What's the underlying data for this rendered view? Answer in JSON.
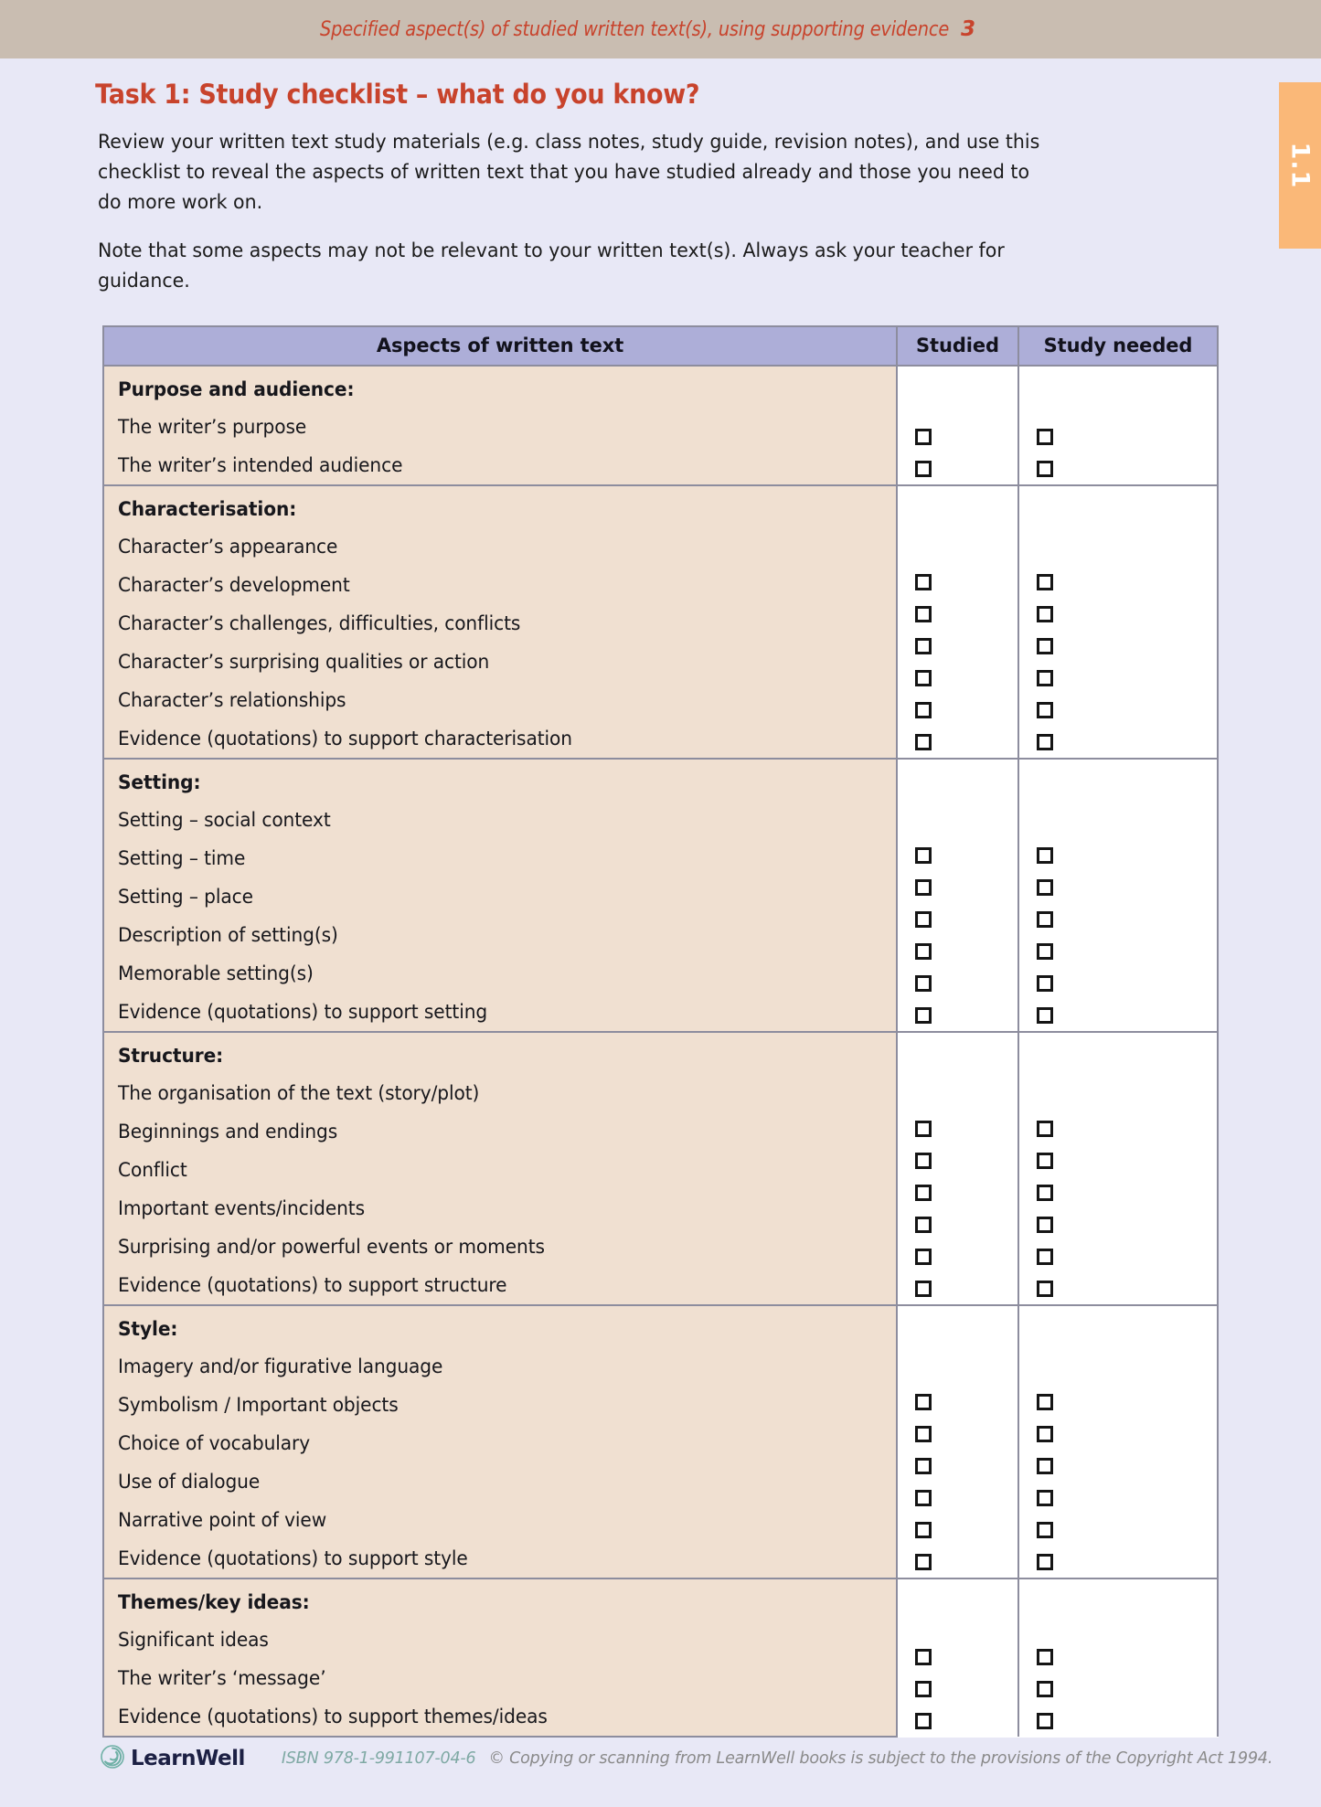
{
  "running_head": {
    "text": "Specified aspect(s) of studied written text(s), using supporting evidence",
    "page_number": "3"
  },
  "side_tab": {
    "label": "1.1",
    "color": "#fab878"
  },
  "task": {
    "title": "Task 1: Study checklist – what do you know?",
    "title_color": "#c8432c",
    "intro_paragraph_1": "Review your written text study materials (e.g. class notes, study guide, revision notes), and use this checklist to reveal the aspects of written text that you have studied already and those you need to do more work on.",
    "intro_paragraph_2": "Note that some aspects may not be relevant to your written text(s). Always ask your teacher for guidance."
  },
  "checklist": {
    "columns": [
      "Aspects of written text",
      "Studied",
      "Study needed"
    ],
    "header_bg": "#adaed8",
    "aspect_bg": "#f0e0d1",
    "sections": [
      {
        "heading": "Purpose and audience:",
        "items": [
          "The writer’s purpose",
          "The writer’s intended audience"
        ]
      },
      {
        "heading": "Characterisation:",
        "items": [
          "Character’s appearance",
          "Character’s development",
          "Character’s challenges, difficulties, conflicts",
          "Character’s surprising qualities or action",
          "Character’s relationships",
          "Evidence (quotations) to support characterisation"
        ]
      },
      {
        "heading": "Setting:",
        "items": [
          "Setting – social context",
          "Setting – time",
          "Setting – place",
          "Description of setting(s)",
          "Memorable setting(s)",
          "Evidence (quotations) to support setting"
        ]
      },
      {
        "heading": "Structure:",
        "items": [
          "The organisation of the text (story/plot)",
          "Beginnings and endings",
          "Conflict",
          "Important events/incidents",
          "Surprising and/or powerful events or moments",
          "Evidence (quotations) to support structure"
        ]
      },
      {
        "heading": "Style:",
        "items": [
          "Imagery and/or figurative language",
          "Symbolism / Important objects",
          "Choice of vocabulary",
          "Use of dialogue",
          "Narrative point of view",
          "Evidence (quotations) to support style"
        ]
      },
      {
        "heading": "Themes/key ideas:",
        "items": [
          "Significant ideas",
          "The writer’s ‘message’",
          "Evidence (quotations) to support themes/ideas"
        ]
      }
    ]
  },
  "footer": {
    "brand": "LearnWell",
    "logo_icon": "spiral-icon",
    "isbn": "ISBN 978-1-991107-04-6",
    "copyright": "© Copying or scanning from LearnWell books is subject to the provisions of the Copyright Act 1994."
  }
}
